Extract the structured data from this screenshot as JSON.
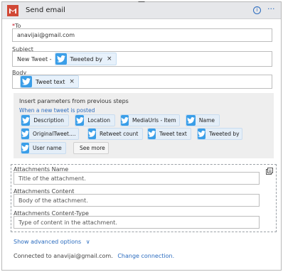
{
  "header": {
    "title": "Send email",
    "info_icon": "i",
    "more_icon": "···"
  },
  "to": {
    "required_mark": "*",
    "label": "To",
    "value": "anavijai@gmail.com"
  },
  "subject": {
    "label": "Subject",
    "prefix": "New Tweet -",
    "token": {
      "label": "Tweeted by",
      "remove": "×"
    }
  },
  "body": {
    "label": "Body",
    "token": {
      "label": "Tweet text",
      "remove": "×"
    }
  },
  "params": {
    "title": "Insert parameters from previous steps",
    "subtitle": "When a new tweet is posted",
    "chips": [
      "Description",
      "Location",
      "MediaUrls - Item",
      "Name",
      "OriginalTweet....",
      "Retweet count",
      "Tweet text",
      "Tweeted by",
      "User name"
    ],
    "see_more": "See more"
  },
  "attachments": {
    "name": {
      "label": "Attachments Name",
      "placeholder": "Title of the attachment."
    },
    "content": {
      "label": "Attachments Content",
      "placeholder": "Body of the attachment."
    },
    "content_type": {
      "label": "Attachments Content-Type",
      "placeholder": "Type of content in the attachment."
    }
  },
  "advanced": {
    "label": "Show advanced options",
    "chevron": "∨"
  },
  "footer": {
    "connected": "Connected to anavijai@gmail.com.",
    "change": "Change connection."
  },
  "colors": {
    "accent": "#2b6cbf",
    "twitter": "#3a9ee8",
    "gmail": "#d14836",
    "header_bg": "#e6e7ea"
  },
  "icons": {
    "gmail": "gmail-icon",
    "twitter": "twitter-icon",
    "info": "info-icon",
    "more": "more-icon",
    "attachment_action": "attachment-icon"
  }
}
